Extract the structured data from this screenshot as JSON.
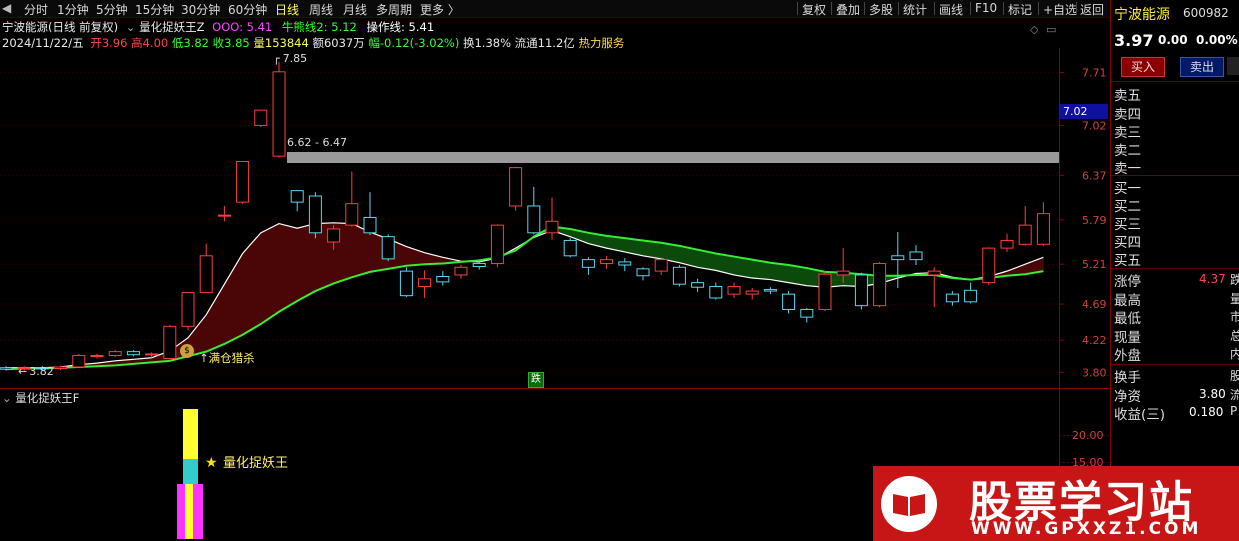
{
  "toolbar": {
    "items": [
      "分时",
      "1分钟",
      "5分钟",
      "15分钟",
      "30分钟",
      "60分钟",
      "日线",
      "周线",
      "月线",
      "多周期",
      "更多 〉"
    ],
    "right_items": [
      "复权",
      "叠加",
      "多股",
      "统计",
      "画线",
      "F10",
      "标记",
      "+自选",
      "返回"
    ]
  },
  "header": {
    "stock_title": "宁波能源(日线 前复权)",
    "indicator_name": "量化捉妖王Z",
    "ind_values": [
      {
        "label": "OOO:",
        "value": "5.41",
        "color": "#ff44ff"
      },
      {
        "label": "牛熊线2:",
        "value": "5.12",
        "color": "#33ff33"
      },
      {
        "label": "操作线:",
        "value": "5.41",
        "color": "#ffffff"
      }
    ]
  },
  "quote_row": {
    "date": "2024/11/22/五",
    "open_label": "开",
    "open": "3.96",
    "high_label": "高",
    "high": "4.00",
    "low_label": "低",
    "low": "3.82",
    "close_label": "收",
    "close": "3.85",
    "volume": "量153844",
    "amount": "额6037万",
    "change": "幅-0.12(-3.02%)",
    "turnover": "换1.38%",
    "float": "流通11.2亿",
    "service": "热力服务"
  },
  "price_axis": [
    "7.71",
    "7.02",
    "6.37",
    "5.79",
    "5.21",
    "4.69",
    "4.22",
    "3.80"
  ],
  "current_price_tag": "7.02",
  "annotations": {
    "high_mark": "7.85",
    "low_mark": "3.82",
    "range_label": "6.62 - 6.47",
    "buy_signal": "满仓猎杀",
    "green_marker": "跌"
  },
  "lower_panel": {
    "title": "量化捉妖王F",
    "star_label": "量化捉妖王",
    "axis": [
      "20.00",
      "15.00"
    ]
  },
  "right_panel": {
    "stock_name": "宁波能源",
    "code": "600982",
    "price": "3.97",
    "change": "0.00",
    "change_pct": "0.00%",
    "buy_button": "买入",
    "sell_button": "卖出",
    "sell_levels": [
      "卖五",
      "卖四",
      "卖三",
      "卖二",
      "卖一"
    ],
    "buy_levels": [
      "买一",
      "买二",
      "买三",
      "买四",
      "买五"
    ],
    "stats": [
      {
        "label": "涨停",
        "value": "4.37",
        "suffix": "跌"
      },
      {
        "label": "最高",
        "value": "",
        "suffix": "量"
      },
      {
        "label": "最低",
        "value": "",
        "suffix": "市"
      },
      {
        "label": "现量",
        "value": "",
        "suffix": "总"
      },
      {
        "label": "外盘",
        "value": "",
        "suffix": "内"
      },
      {
        "label": "换手",
        "value": "",
        "suffix": "股"
      },
      {
        "label": "净资",
        "value": "3.80",
        "suffix": "流"
      },
      {
        "label": "收益(三)",
        "value": "0.180",
        "suffix": "P"
      }
    ]
  },
  "watermark": {
    "big": "股票学习站",
    "url": "WWW.GPXXZ1.COM"
  },
  "chart_data": {
    "type": "candlestick",
    "ylim": [
      3.7,
      7.9
    ],
    "candles": [
      {
        "o": 3.86,
        "c": 3.84,
        "h": 3.88,
        "l": 3.82
      },
      {
        "o": 3.85,
        "c": 3.86,
        "h": 3.88,
        "l": 3.82
      },
      {
        "o": 3.86,
        "c": 3.85,
        "h": 3.88,
        "l": 3.83
      },
      {
        "o": 3.85,
        "c": 3.87,
        "h": 3.89,
        "l": 3.83
      },
      {
        "o": 3.87,
        "c": 4.02,
        "h": 4.04,
        "l": 3.86
      },
      {
        "o": 4.02,
        "c": 4.02,
        "h": 4.04,
        "l": 3.98
      },
      {
        "o": 4.02,
        "c": 4.07,
        "h": 4.09,
        "l": 4.0
      },
      {
        "o": 4.07,
        "c": 4.03,
        "h": 4.09,
        "l": 4.01
      },
      {
        "o": 4.03,
        "c": 4.04,
        "h": 4.06,
        "l": 3.99
      },
      {
        "o": 3.98,
        "c": 4.4,
        "h": 4.42,
        "l": 3.97
      },
      {
        "o": 4.4,
        "c": 4.84,
        "h": 4.84,
        "l": 4.35
      },
      {
        "o": 4.84,
        "c": 5.32,
        "h": 5.48,
        "l": 4.84
      },
      {
        "o": 5.84,
        "c": 5.85,
        "h": 5.97,
        "l": 5.77
      },
      {
        "o": 6.02,
        "c": 6.55,
        "h": 6.55,
        "l": 6.0
      },
      {
        "o": 7.02,
        "c": 7.22,
        "h": 7.22,
        "l": 7.0
      },
      {
        "o": 6.62,
        "c": 7.72,
        "h": 7.85,
        "l": 6.6
      },
      {
        "o": 6.17,
        "c": 6.02,
        "h": 6.18,
        "l": 5.9
      },
      {
        "o": 6.1,
        "c": 5.62,
        "h": 6.15,
        "l": 5.55
      },
      {
        "o": 5.5,
        "c": 5.67,
        "h": 5.72,
        "l": 5.4
      },
      {
        "o": 5.72,
        "c": 6.0,
        "h": 6.42,
        "l": 5.7
      },
      {
        "o": 5.82,
        "c": 5.62,
        "h": 6.15,
        "l": 5.59
      },
      {
        "o": 5.57,
        "c": 5.28,
        "h": 5.6,
        "l": 5.25
      },
      {
        "o": 5.12,
        "c": 4.8,
        "h": 5.17,
        "l": 4.78
      },
      {
        "o": 4.92,
        "c": 5.02,
        "h": 5.13,
        "l": 4.77
      },
      {
        "o": 5.05,
        "c": 4.98,
        "h": 5.12,
        "l": 4.93
      },
      {
        "o": 5.07,
        "c": 5.17,
        "h": 5.2,
        "l": 5.02
      },
      {
        "o": 5.22,
        "c": 5.18,
        "h": 5.27,
        "l": 5.14
      },
      {
        "o": 5.22,
        "c": 5.72,
        "h": 5.73,
        "l": 5.17
      },
      {
        "o": 5.97,
        "c": 6.47,
        "h": 6.48,
        "l": 5.91
      },
      {
        "o": 5.97,
        "c": 5.62,
        "h": 6.22,
        "l": 5.6
      },
      {
        "o": 5.62,
        "c": 5.77,
        "h": 6.08,
        "l": 5.53
      },
      {
        "o": 5.52,
        "c": 5.32,
        "h": 5.55,
        "l": 5.3
      },
      {
        "o": 5.27,
        "c": 5.17,
        "h": 5.3,
        "l": 5.07
      },
      {
        "o": 5.22,
        "c": 5.27,
        "h": 5.32,
        "l": 5.15
      },
      {
        "o": 5.24,
        "c": 5.2,
        "h": 5.29,
        "l": 5.12
      },
      {
        "o": 5.15,
        "c": 5.06,
        "h": 5.17,
        "l": 5.0
      },
      {
        "o": 5.12,
        "c": 5.27,
        "h": 5.3,
        "l": 5.07
      },
      {
        "o": 5.17,
        "c": 4.95,
        "h": 5.2,
        "l": 4.92
      },
      {
        "o": 4.97,
        "c": 4.91,
        "h": 5.02,
        "l": 4.85
      },
      {
        "o": 4.92,
        "c": 4.77,
        "h": 4.97,
        "l": 4.75
      },
      {
        "o": 4.82,
        "c": 4.92,
        "h": 4.97,
        "l": 4.77
      },
      {
        "o": 4.82,
        "c": 4.86,
        "h": 4.9,
        "l": 4.75
      },
      {
        "o": 4.88,
        "c": 4.86,
        "h": 4.91,
        "l": 4.82
      },
      {
        "o": 4.82,
        "c": 4.62,
        "h": 4.86,
        "l": 4.57
      },
      {
        "o": 4.62,
        "c": 4.52,
        "h": 4.64,
        "l": 4.45
      },
      {
        "o": 4.62,
        "c": 5.08,
        "h": 5.12,
        "l": 4.6
      },
      {
        "o": 5.07,
        "c": 5.12,
        "h": 5.42,
        "l": 4.97
      },
      {
        "o": 5.07,
        "c": 4.67,
        "h": 5.1,
        "l": 4.62
      },
      {
        "o": 4.67,
        "c": 5.22,
        "h": 5.24,
        "l": 4.65
      },
      {
        "o": 5.32,
        "c": 5.27,
        "h": 5.63,
        "l": 4.9
      },
      {
        "o": 5.37,
        "c": 5.27,
        "h": 5.46,
        "l": 5.2
      },
      {
        "o": 5.07,
        "c": 5.12,
        "h": 5.17,
        "l": 4.65
      },
      {
        "o": 4.82,
        "c": 4.72,
        "h": 4.86,
        "l": 4.67
      },
      {
        "o": 4.87,
        "c": 4.72,
        "h": 4.97,
        "l": 4.7
      },
      {
        "o": 4.97,
        "c": 5.42,
        "h": 5.43,
        "l": 4.94
      },
      {
        "o": 5.42,
        "c": 5.52,
        "h": 5.61,
        "l": 5.37
      },
      {
        "o": 5.47,
        "c": 5.72,
        "h": 5.97,
        "l": 5.45
      },
      {
        "o": 5.47,
        "c": 5.87,
        "h": 6.02,
        "l": 5.45
      }
    ],
    "series": [
      {
        "name": "OOO",
        "values": [
          3.86,
          3.86,
          3.86,
          3.87,
          3.9,
          3.92,
          3.95,
          3.97,
          3.99,
          4.08,
          4.25,
          4.55,
          4.95,
          5.35,
          5.62,
          5.74,
          5.68,
          5.74,
          5.75,
          5.74,
          5.63,
          5.54,
          5.44,
          5.36,
          5.3,
          5.25,
          5.24,
          5.29,
          5.42,
          5.56,
          5.65,
          5.57,
          5.48,
          5.42,
          5.37,
          5.32,
          5.28,
          5.23,
          5.17,
          5.13,
          5.07,
          5.03,
          5.01,
          4.97,
          4.93,
          4.91,
          4.93,
          4.92,
          4.96,
          5.03,
          5.09,
          5.1,
          5.04,
          5.01,
          5.05,
          5.12,
          5.21,
          5.3
        ]
      },
      {
        "name": "牛熊线2",
        "values": [
          3.84,
          3.85,
          3.85,
          3.86,
          3.87,
          3.88,
          3.89,
          3.91,
          3.93,
          3.95,
          4.01,
          4.07,
          4.17,
          4.29,
          4.43,
          4.59,
          4.73,
          4.86,
          4.96,
          5.04,
          5.11,
          5.15,
          5.19,
          5.21,
          5.22,
          5.24,
          5.26,
          5.3,
          5.39,
          5.57,
          5.7,
          5.67,
          5.62,
          5.58,
          5.55,
          5.52,
          5.49,
          5.45,
          5.4,
          5.35,
          5.31,
          5.27,
          5.23,
          5.2,
          5.16,
          5.11,
          5.1,
          5.08,
          5.06,
          5.06,
          5.07,
          5.07,
          5.03,
          5.01,
          5.03,
          5.06,
          5.08,
          5.12
        ]
      }
    ]
  }
}
